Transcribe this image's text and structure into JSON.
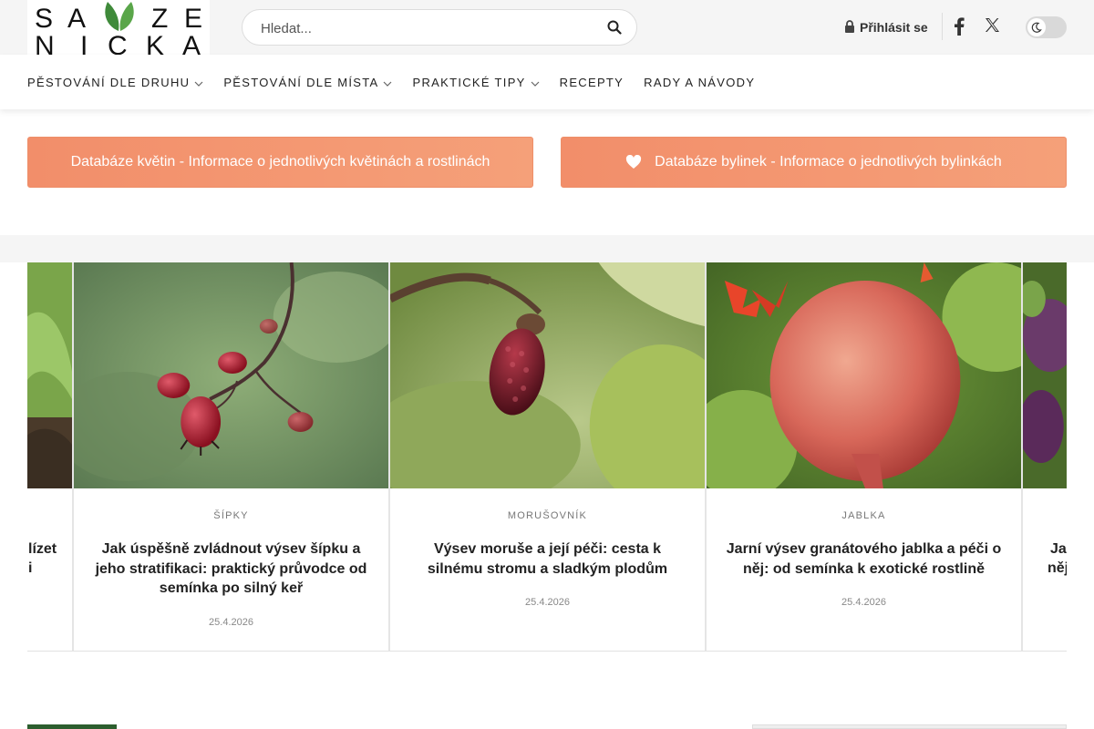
{
  "header": {
    "logo_text": "SAZENICKA",
    "search_placeholder": "Hledat...",
    "login_label": "Přihlásit se"
  },
  "nav": {
    "items": [
      {
        "label": "PĚSTOVÁNÍ DLE DRUHU",
        "has_dropdown": true
      },
      {
        "label": "PĚSTOVÁNÍ DLE MÍSTA",
        "has_dropdown": true
      },
      {
        "label": "PRAKTICKÉ TIPY",
        "has_dropdown": true
      },
      {
        "label": "RECEPTY",
        "has_dropdown": false
      },
      {
        "label": "RADY A NÁVODY",
        "has_dropdown": false
      }
    ]
  },
  "databases": {
    "flowers_label": "Databáze květin - Informace o jednotlivých květinách a rostlinách",
    "herbs_label": "Databáze bylinek - Informace o jednotlivých bylinkách"
  },
  "carousel": {
    "partial_left_title": "lízet\ni",
    "cards": [
      {
        "category": "ŠÍPKY",
        "title": "Jak úspěšně zvládnout výsev šípku a jeho stratifikaci: praktický průvodce od semínka po silný keř",
        "date": "25.4.2026"
      },
      {
        "category": "MORUŠOVNÍK",
        "title": "Výsev moruše a její péči: cesta k silnému stromu a sladkým plodům",
        "date": "25.4.2026"
      },
      {
        "category": "JABLKA",
        "title": "Jarní výsev granátového jablka a péči o něj: od semínka k exotické rostlině",
        "date": "25.4.2026"
      }
    ],
    "partial_right_title": "Ja\nněj"
  },
  "colors": {
    "accent_button": "#f28e6a",
    "brand_green": "#2c5e2e"
  }
}
